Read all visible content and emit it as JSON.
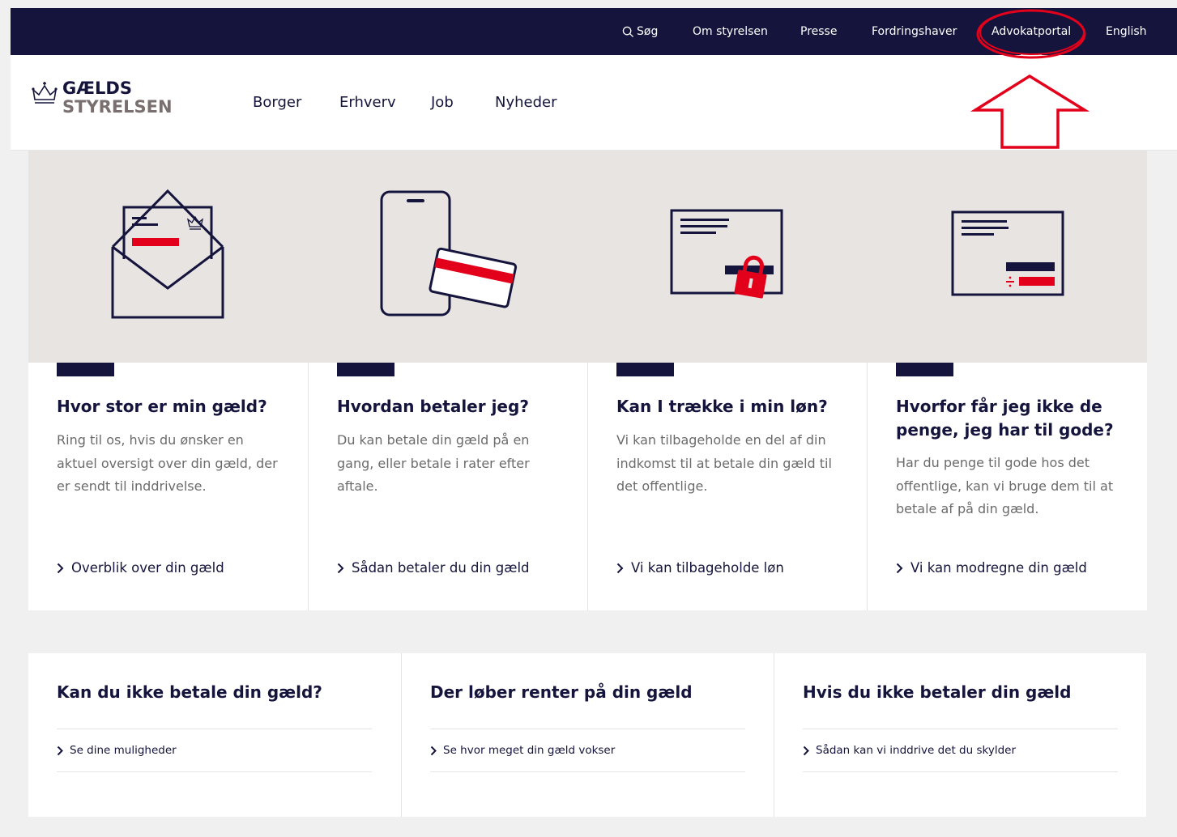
{
  "top_nav": {
    "search": "Søg",
    "about": "Om styrelsen",
    "press": "Presse",
    "creditor": "Fordringshaver",
    "lawyer_portal": "Advokatportal",
    "english": "English"
  },
  "logo": {
    "line1": "GÆLDS",
    "line2": "STYRELSEN"
  },
  "main_nav": {
    "citizen": "Borger",
    "business": "Erhverv",
    "job": "Job",
    "news": "Nyheder"
  },
  "cards": [
    {
      "title": "Hvor stor er min gæld?",
      "text": "Ring til os, hvis du ønsker en aktuel oversigt over din gæld, der er sendt til inddrivelse.",
      "link": "Overblik over din gæld"
    },
    {
      "title": "Hvordan betaler jeg?",
      "text": "Du kan betale din gæld på en gang, eller betale i rater efter aftale.",
      "link": "Sådan betaler du din gæld"
    },
    {
      "title": "Kan I trække i min løn?",
      "text": "Vi kan tilbageholde en del af din indkomst til at betale din gæld til det offentlige.",
      "link": "Vi kan tilbageholde løn"
    },
    {
      "title": "Hvorfor får jeg ikke de penge, jeg har til gode?",
      "text": "Har du penge til gode hos det offentlige, kan vi bruge dem til at betale af på din gæld.",
      "link": "Vi kan modregne din gæld"
    }
  ],
  "panels": [
    {
      "title": "Kan du ikke betale din gæld?",
      "link": "Se dine muligheder"
    },
    {
      "title": "Der løber renter på din gæld",
      "link": "Se hvor meget din gæld vokser"
    },
    {
      "title": "Hvis du ikke betaler din gæld",
      "link": "Sådan kan vi inddrive det du skylder"
    }
  ],
  "colors": {
    "navy": "#14143c",
    "red": "#e3001b",
    "hero_bg": "#e8e4e2",
    "annotation": "#e3001b"
  }
}
